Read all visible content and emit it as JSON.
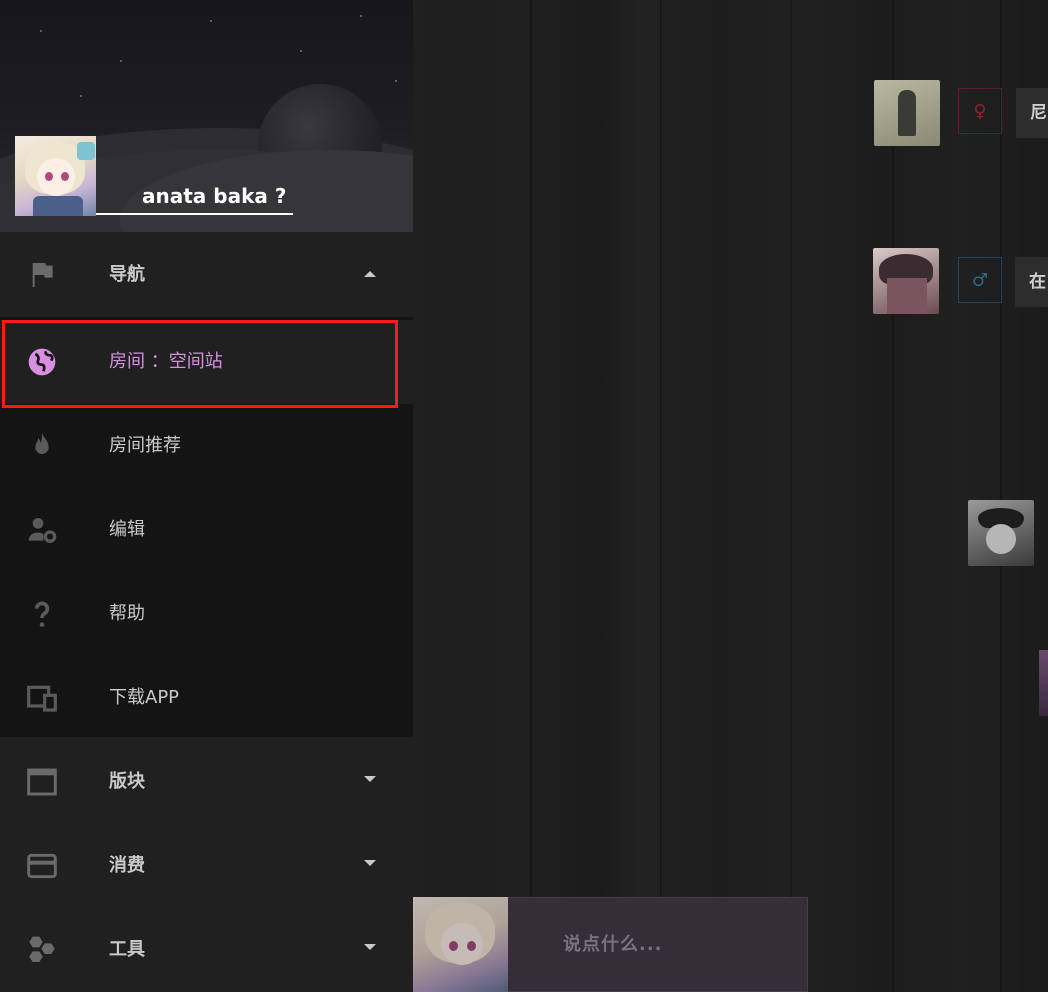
{
  "user": {
    "name": "anata baka ?"
  },
  "nav": {
    "section_label": "导航",
    "items": [
      {
        "label": "房间 ：空间站",
        "icon": "globe-icon",
        "selected": true
      },
      {
        "label": "房间推荐",
        "icon": "fire-icon"
      },
      {
        "label": "编辑",
        "icon": "user-settings-icon"
      },
      {
        "label": "帮助",
        "icon": "question-icon"
      },
      {
        "label": "下载APP",
        "icon": "devices-icon"
      }
    ]
  },
  "groups": [
    {
      "label": "版块",
      "icon": "window-icon"
    },
    {
      "label": "消费",
      "icon": "credit-card-icon"
    },
    {
      "label": "工具",
      "icon": "hexagons-icon"
    }
  ],
  "chat": {
    "messages": [
      {
        "gender_symbol": "♀",
        "gender_color": "#8a2233",
        "bubble_text": "尼"
      },
      {
        "gender_symbol": "♂",
        "gender_color": "#2d6a8a",
        "bubble_text": "在"
      }
    ],
    "input_placeholder": "说点什么..."
  },
  "colors": {
    "accent": "#d88fe0",
    "highlight_box": "#ff1a1a"
  }
}
